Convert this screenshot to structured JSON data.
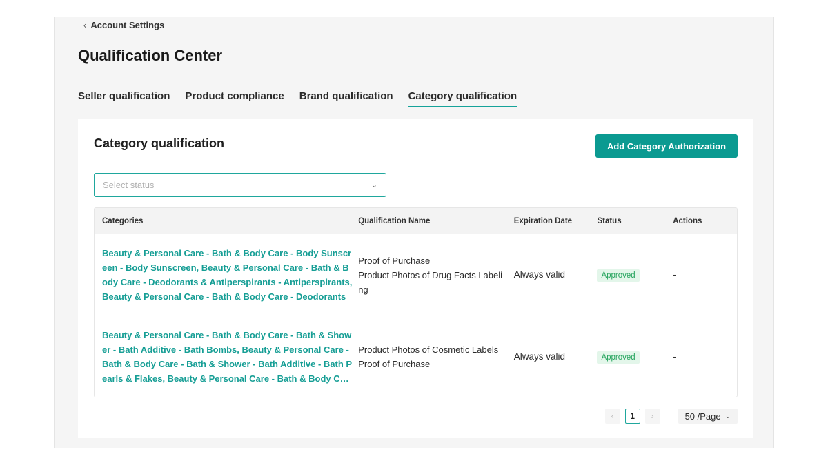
{
  "breadcrumb": {
    "icon": "chevron-left-icon",
    "label": "Account Settings"
  },
  "page_title": "Qualification Center",
  "tabs": [
    {
      "label": "Seller qualification",
      "active": false
    },
    {
      "label": "Product compliance",
      "active": false
    },
    {
      "label": "Brand qualification",
      "active": false
    },
    {
      "label": "Category qualification",
      "active": true
    }
  ],
  "card": {
    "title": "Category qualification",
    "add_button_label": "Add Category Authorization",
    "status_select": {
      "placeholder": "Select status",
      "icon": "chevron-down-icon"
    }
  },
  "table": {
    "columns": [
      "Categories",
      "Qualification Name",
      "Expiration Date",
      "Status",
      "Actions"
    ],
    "rows": [
      {
        "categories": "Beauty & Personal Care - Bath & Body Care - Body Sunscreen - Body Sunscreen, Beauty & Personal Care - Bath & Body Care - Deodorants & Antiperspirants - Antiperspirants, Beauty & Personal Care - Bath & Body Care - Deodorants",
        "qualifications": [
          "Proof of Purchase",
          "Product Photos of Drug Facts Labeling"
        ],
        "expiration": "Always valid",
        "status": "Approved",
        "actions": "-"
      },
      {
        "categories": "Beauty & Personal Care - Bath & Body Care - Bath & Shower - Bath Additive - Bath Bombs, Beauty & Personal Care - Bath & Body Care - Bath & Shower - Bath Additive - Bath Pearls & Flakes, Beauty & Personal Care - Bath & Body Care",
        "qualifications": [
          "Product Photos of Cosmetic Labels",
          "Proof of Purchase"
        ],
        "expiration": "Always valid",
        "status": "Approved",
        "actions": "-"
      }
    ]
  },
  "pagination": {
    "prev_icon": "chevron-left-icon",
    "current_page": "1",
    "next_icon": "chevron-right-icon",
    "page_size_label": "50 /Page"
  },
  "colors": {
    "accent": "#0b9a91",
    "link": "#169e95",
    "approved_bg": "#e3f6ea",
    "approved_text": "#27a55f"
  }
}
